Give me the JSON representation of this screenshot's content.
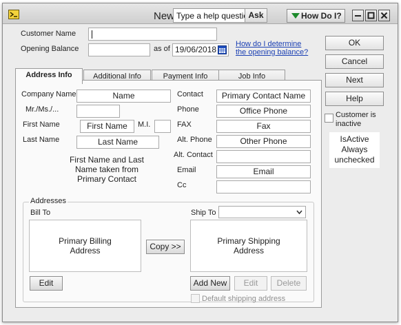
{
  "window": {
    "title": "New",
    "help_placeholder": "Type a help question",
    "ask_label": "Ask",
    "how_do_i_label": "How Do I?"
  },
  "customer": {
    "name_label": "Customer Name",
    "name_value": "",
    "opening_balance_label": "Opening Balance",
    "opening_balance_value": "",
    "as_of_label": "as of",
    "as_of_date": "19/06/2018",
    "help_link_line1": "How do I determine",
    "help_link_line2": "the opening balance?"
  },
  "tabs": [
    {
      "label": "Address Info",
      "active": true
    },
    {
      "label": "Additional Info",
      "active": false
    },
    {
      "label": "Payment Info",
      "active": false
    },
    {
      "label": "Job Info",
      "active": false
    }
  ],
  "address_info": {
    "company_name_label": "Company Name",
    "company_name_value": "Name",
    "salutation_label": "Mr./Ms./...",
    "salutation_value": "",
    "first_name_label": "First Name",
    "first_name_value": "First Name",
    "mi_label": "M.I.",
    "mi_value": "",
    "last_name_label": "Last Name",
    "last_name_value": "Last Name",
    "name_note_line1": "First Name and Last",
    "name_note_line2": "Name taken from",
    "name_note_line3": "Primary Contact",
    "contact_label": "Contact",
    "contact_value": "Primary Contact Name",
    "phone_label": "Phone",
    "phone_value": "Office Phone",
    "fax_label": "FAX",
    "fax_value": "Fax",
    "alt_phone_label": "Alt. Phone",
    "alt_phone_value": "Other Phone",
    "alt_contact_label": "Alt. Contact",
    "alt_contact_value": "",
    "email_label": "Email",
    "email_value": "Email",
    "cc_label": "Cc",
    "cc_value": ""
  },
  "addresses": {
    "group_label": "Addresses",
    "bill_to_label": "Bill To",
    "bill_to_line1": "Primary Billing",
    "bill_to_line2": "Address",
    "copy_label": "Copy >>",
    "ship_to_label": "Ship To",
    "ship_to_value": "",
    "ship_to_line1": "Primary Shipping",
    "ship_to_line2": "Address",
    "edit_label": "Edit",
    "add_new_label": "Add New",
    "ship_edit_label": "Edit",
    "delete_label": "Delete",
    "default_shipping_label": "Default shipping address"
  },
  "side_buttons": {
    "ok": "OK",
    "cancel": "Cancel",
    "next": "Next",
    "help": "Help",
    "inactive_line1": "Customer is",
    "inactive_line2": "inactive"
  },
  "note": {
    "line1": "IsActive",
    "line2": "Always",
    "line3": "unchecked"
  },
  "colors": {
    "link": "#1a3fb3",
    "how_do_i_arrow": "#1c8a2c",
    "calendar_icon": "#1f4fbf"
  }
}
